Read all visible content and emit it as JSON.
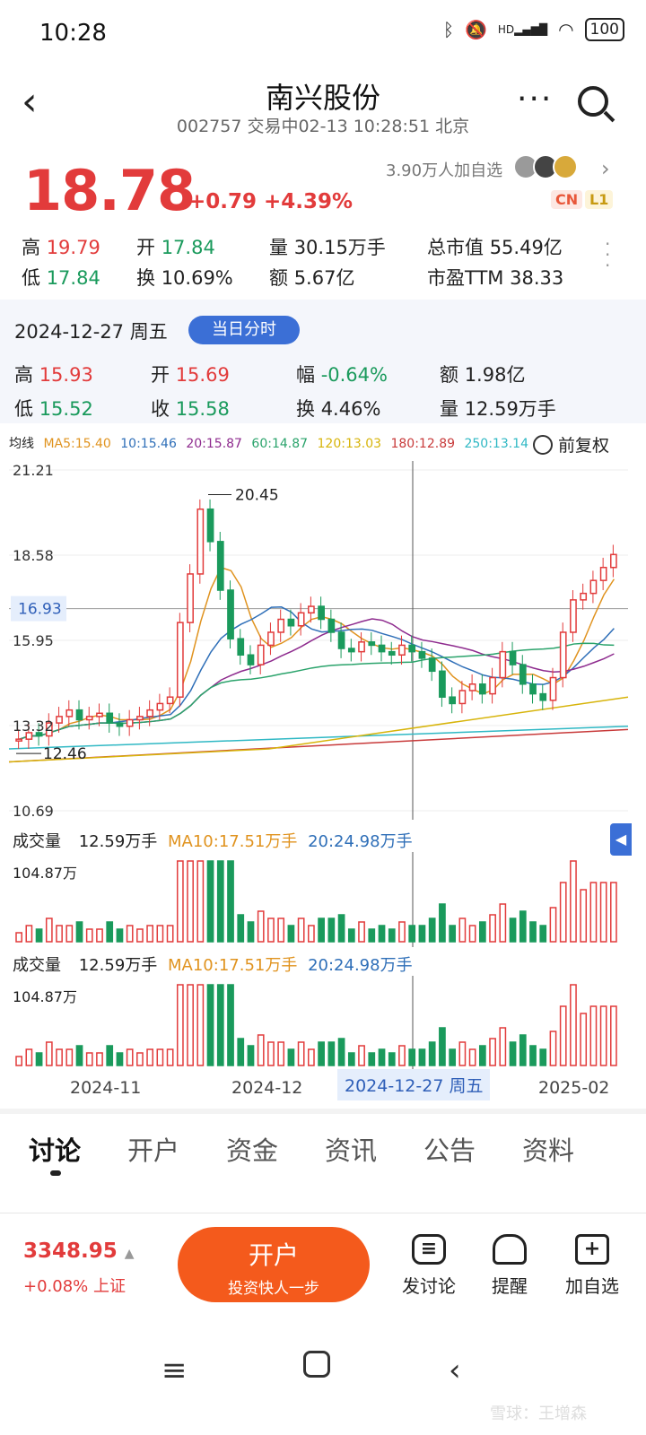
{
  "status_bar": {
    "time": "10:28",
    "icons": [
      "bluetooth-icon",
      "mute-icon",
      "signal-icon",
      "wifi-icon"
    ],
    "hd": "HD",
    "battery": "100"
  },
  "header": {
    "title": "南兴股份",
    "subtitle": "002757 交易中02-13 10:28:51 北京"
  },
  "quote": {
    "price": "18.78",
    "change": "+0.79 +4.39%",
    "followers": "3.90万人加自选",
    "tags": [
      "CN",
      "L1"
    ],
    "high_label": "高",
    "high": "19.79",
    "low_label": "低",
    "low": "17.84",
    "open_label": "开",
    "open": "17.84",
    "turnover_label": "换",
    "turnover": "10.69%",
    "volume_label": "量",
    "volume": "30.15万手",
    "amount_label": "额",
    "amount": "5.67亿",
    "mktcap_label": "总市值",
    "mktcap": "55.49亿",
    "pe_label": "市盈TTM",
    "pe": "38.33"
  },
  "day_info": {
    "date": "2024-12-27 周五",
    "button": "当日分时",
    "high_label": "高",
    "high": "15.93",
    "low_label": "低",
    "low": "15.52",
    "open_label": "开",
    "open": "15.69",
    "close_label": "收",
    "close": "15.58",
    "range_label": "幅",
    "range": "-0.64%",
    "turnover_label": "换",
    "turnover": "4.46%",
    "amount_label": "额",
    "amount": "1.98亿",
    "volume_label": "量",
    "volume": "12.59万手"
  },
  "ma_legend": {
    "title": "均线",
    "items": [
      {
        "text": "MA5:15.40",
        "color": "#e0931f"
      },
      {
        "text": "10:15.46",
        "color": "#2f6fb8"
      },
      {
        "text": "20:15.87",
        "color": "#8e2b8e"
      },
      {
        "text": "60:14.87",
        "color": "#2aa36b"
      },
      {
        "text": "120:13.03",
        "color": "#d7b40a"
      },
      {
        "text": "180:12.89",
        "color": "#c83a3a"
      },
      {
        "text": "250:13.14",
        "color": "#2fb8c4"
      }
    ],
    "restore": "前复权"
  },
  "kline": {
    "y_ticks": [
      "21.21",
      "18.58",
      "15.95",
      "13.32",
      "10.69"
    ],
    "crosshair_price": "16.93",
    "max_label": "20.45",
    "min_label": "12.46"
  },
  "volume_panel": {
    "title": "成交量",
    "vol": "12.59万手",
    "ma10": "MA10:17.51万手",
    "ma20": "20:24.98万手",
    "max": "104.87万"
  },
  "x_axis": {
    "labels": [
      "2024-11",
      "2024-12",
      "2025-02"
    ],
    "highlight": "2024-12-27 周五"
  },
  "tabs": [
    "讨论",
    "开户",
    "资金",
    "资讯",
    "公告",
    "资料"
  ],
  "footer": {
    "index_value": "3348.95",
    "index_change": "+0.08% 上证",
    "open_title": "开户",
    "open_sub": "投资快人一步",
    "actions": [
      "发讨论",
      "提醒",
      "加自选"
    ]
  },
  "watermark": "雪球：王增森",
  "colors": {
    "up": "#e23b3b",
    "down": "#1a9a5c",
    "accent": "#3b6fd6",
    "cta": "#f45a1c"
  }
}
